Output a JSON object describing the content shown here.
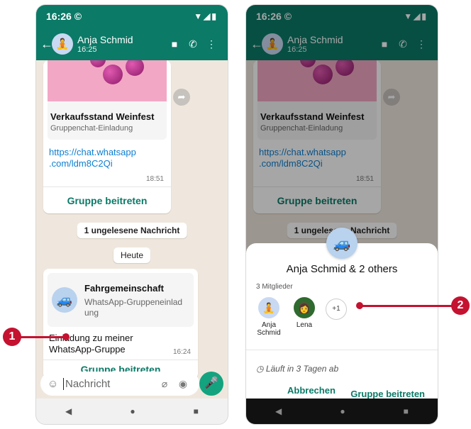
{
  "colors": {
    "accent": "#0b7a67",
    "link": "#0d7fd0",
    "callout": "#c41230",
    "chat_bg": "#efe7dd"
  },
  "status": {
    "time": "16:26",
    "whatsapp_glyph": "©",
    "sys": "▼◢▮"
  },
  "contact": {
    "name": "Anja Schmid",
    "subtitle": "16:25"
  },
  "left": {
    "invite_title": "Verkaufsstand Weinfest",
    "invite_sub": "Gruppenchat-Einladung",
    "link_line1": "https://chat.whatsapp",
    "link_line2": ".com/ldm8C2Qi",
    "link_time": "18:51",
    "join_label": "Gruppe beitreten",
    "unread": "1 ungelesene Nachricht",
    "today": "Heute",
    "group_title": "Fahrgemeinschaft",
    "group_sub_line1": "WhatsApp-Gruppeneinlad",
    "group_sub_line2": "ung",
    "msg_line1": "Einladung zu meiner",
    "msg_line2": "WhatsApp-Gruppe",
    "msg_time": "16:24",
    "join_label2": "Gruppe beitreten",
    "placeholder": "Nachricht"
  },
  "sheet": {
    "title": "Anja Schmid & 2 others",
    "members_count": "3 Mitglieder",
    "member1_line1": "Anja",
    "member1_line2": "Schmid",
    "member2": "Lena",
    "more": "+1",
    "expire_icon": "◷",
    "expire": "Läuft in 3 Tagen ab",
    "cancel": "Abbrechen",
    "join": "Gruppe beitreten"
  },
  "callouts": {
    "one": "1",
    "two": "2"
  },
  "icons": {
    "back": "arrow-left",
    "video": "video-icon",
    "call": "phone-icon",
    "menu": "more-vert-icon"
  }
}
